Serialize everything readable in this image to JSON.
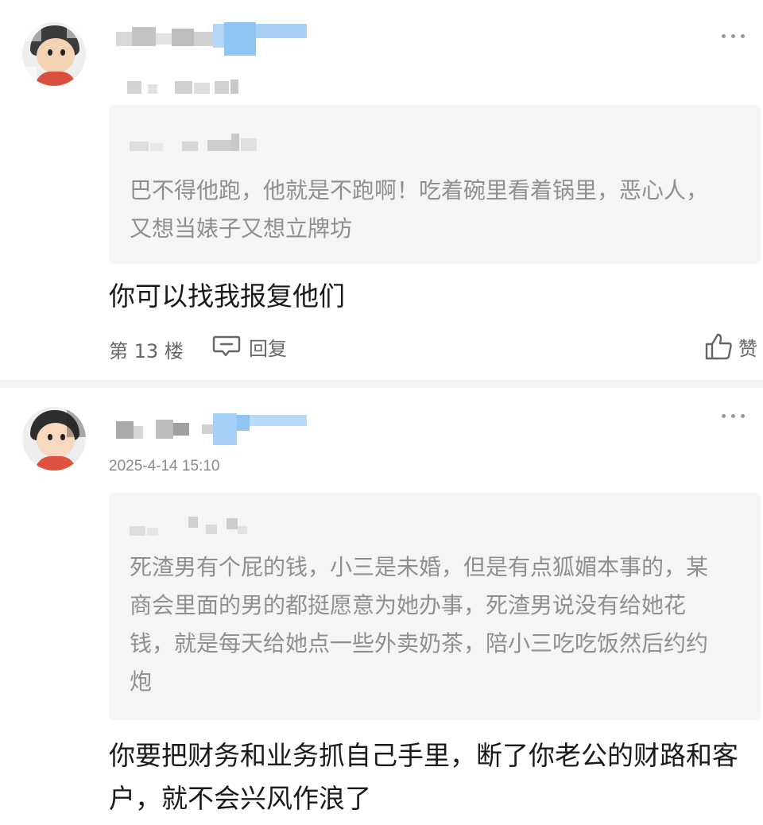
{
  "comments": [
    {
      "quote_text": "巴不得他跑，他就是不跑啊！吃着碗里看着锅里，恶心人，又想当婊子又想立牌坊",
      "reply_text": "你可以找我报复他们",
      "floor": "第 13 楼",
      "reply_label": "回复",
      "like_label": "赞"
    },
    {
      "timestamp": "2025-4-14 15:10",
      "quote_text": "死渣男有个屁的钱，小三是未婚，但是有点狐媚本事的，某商会里面的男的都挺愿意为她办事，死渣男说没有给她花钱，就是每天给她点一些外卖奶茶，陪小三吃吃饭然后约约炮",
      "reply_text": "你要把财务和业务抓自己手里，断了你老公的财路和客户，就不会兴风作浪了"
    }
  ],
  "icons": {
    "more": "more-icon",
    "reply": "comment-bubble-icon",
    "like": "thumbs-up-icon"
  },
  "colors": {
    "username_highlight": "#8fc4f3",
    "quote_background": "#f5f5f5",
    "separator": "#f3f3f3"
  }
}
